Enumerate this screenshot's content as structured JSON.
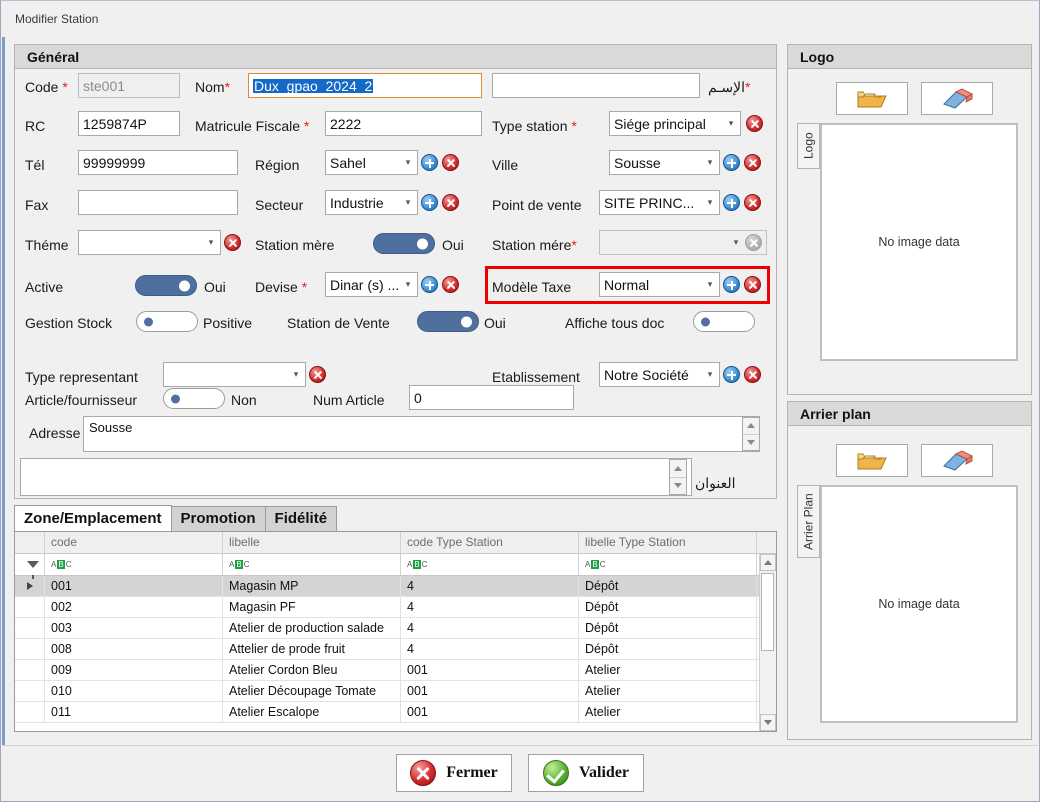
{
  "window": {
    "title": "Modifier Station"
  },
  "general": {
    "title": "Général",
    "code_label": "Code",
    "code_value": "ste001",
    "nom_label": "Nom",
    "nom_value": "Dux_gpao_2024_2",
    "nom_ar_value": "",
    "nom_ar_label": "الإسـم",
    "rc_label": "RC",
    "rc_value": "1259874P",
    "matricule_label": "Matricule Fiscale",
    "matricule_value": "2222",
    "type_station_label": "Type station",
    "type_station_value": "Siége principal",
    "tel_label": "Tél",
    "tel_value": "99999999",
    "region_label": "Région",
    "region_value": "Sahel",
    "ville_label": "Ville",
    "ville_value": "Sousse",
    "fax_label": "Fax",
    "fax_value": "",
    "secteur_label": "Secteur",
    "secteur_value": "Industrie",
    "point_vente_label": "Point de vente",
    "point_vente_value": "SITE PRINC...",
    "theme_label": "Théme",
    "theme_value": "",
    "station_mere_toggle_label": "Station mère",
    "station_mere_toggle_state": "Oui",
    "station_mere_label": "Station mére",
    "station_mere_value": "",
    "active_label": "Active",
    "active_state": "Oui",
    "devise_label": "Devise",
    "devise_value": "Dinar (s) ...",
    "modele_taxe_label": "Modèle Taxe",
    "modele_taxe_value": "Normal",
    "gestion_stock_label": "Gestion Stock",
    "gestion_stock_state": "Positive",
    "station_vente_label": "Station de Vente",
    "station_vente_state": "Oui",
    "affiche_tous_doc_label": "Affiche tous doc",
    "type_representant_label": "Type representant",
    "type_representant_value": "",
    "etablissement_label": "Etablissement",
    "etablissement_value": "Notre Société",
    "article_fournisseur_label": "Article/fournisseur",
    "article_fournisseur_state": "Non",
    "num_article_label": "Num Article",
    "num_article_value": "0",
    "adresse_label": "Adresse",
    "adresse_value": "Sousse",
    "adresse_ar_value": "",
    "adresse_ar_label": "العنوان"
  },
  "tabs": [
    {
      "label": "Zone/Emplacement",
      "active": true
    },
    {
      "label": "Promotion",
      "active": false
    },
    {
      "label": "Fidélité",
      "active": false
    }
  ],
  "grid": {
    "columns": [
      "code",
      "libelle",
      "code Type Station",
      "libelle Type Station"
    ],
    "filter_glyph": "ABC",
    "rows": [
      {
        "code": "001",
        "libelle": "Magasin MP",
        "code_type": "4",
        "libelle_type": "Dépôt",
        "selected": true
      },
      {
        "code": "002",
        "libelle": "Magasin PF",
        "code_type": "4",
        "libelle_type": "Dépôt",
        "selected": false
      },
      {
        "code": "003",
        "libelle": "Atelier de production salade",
        "code_type": "4",
        "libelle_type": "Dépôt",
        "selected": false
      },
      {
        "code": "008",
        "libelle": "Attelier de prode fruit",
        "code_type": "4",
        "libelle_type": "Dépôt",
        "selected": false
      },
      {
        "code": "009",
        "libelle": "Atelier Cordon Bleu",
        "code_type": "001",
        "libelle_type": "Atelier",
        "selected": false
      },
      {
        "code": "010",
        "libelle": "Atelier Découpage Tomate",
        "code_type": "001",
        "libelle_type": "Atelier",
        "selected": false
      },
      {
        "code": "011",
        "libelle": "Atelier Escalope",
        "code_type": "001",
        "libelle_type": "Atelier",
        "selected": false
      }
    ]
  },
  "logo_panel": {
    "title": "Logo",
    "tab_label": "Logo",
    "placeholder": "No image data",
    "browse_icon": "folder-open-icon",
    "clear_icon": "eraser-icon"
  },
  "background_panel": {
    "title": "Arrier plan",
    "tab_label": "Arrier Plan",
    "placeholder": "No image data",
    "browse_icon": "folder-open-icon",
    "clear_icon": "eraser-icon"
  },
  "footer": {
    "close_label": "Fermer",
    "validate_label": "Valider"
  },
  "colors": {
    "accent_blue": "#4f6f9e",
    "selection_blue": "#1569c7",
    "required_red": "#e02020",
    "highlight_red": "#ee0000",
    "panel_bg": "#f0f0f0",
    "header_bg": "#d9d9d9"
  }
}
